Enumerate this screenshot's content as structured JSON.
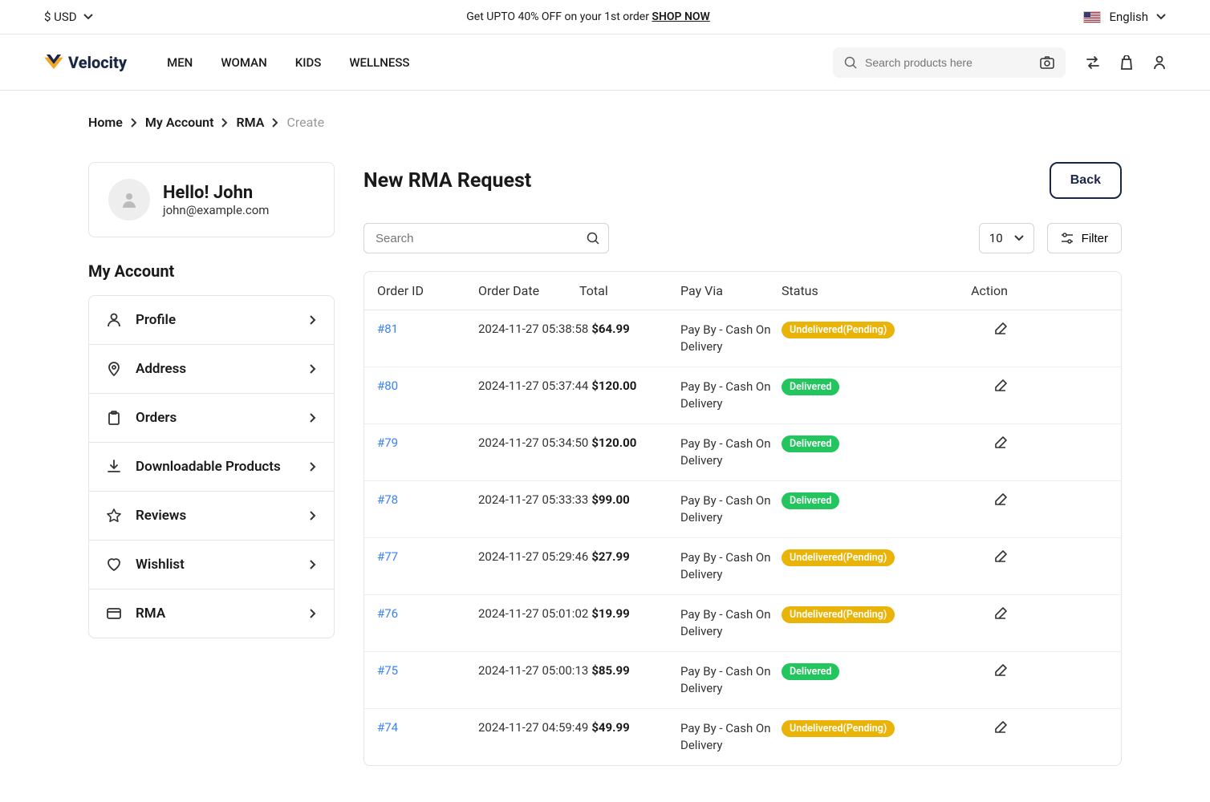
{
  "topbar": {
    "currency": "$ USD",
    "promo_prefix": "Get UPTO 40% OFF on your 1st order ",
    "promo_cta": "SHOP NOW",
    "language": "English"
  },
  "header": {
    "logo_text": "Velocity",
    "nav": [
      "MEN",
      "WOMAN",
      "KIDS",
      "WELLNESS"
    ],
    "search_placeholder": "Search products here"
  },
  "breadcrumb": [
    "Home",
    "My Account",
    "RMA",
    "Create"
  ],
  "user": {
    "greeting": "Hello! John",
    "email": "john@example.com"
  },
  "sidebar": {
    "title": "My Account",
    "items": [
      {
        "label": "Profile",
        "icon": "user"
      },
      {
        "label": "Address",
        "icon": "pin"
      },
      {
        "label": "Orders",
        "icon": "clipboard"
      },
      {
        "label": "Downloadable Products",
        "icon": "download"
      },
      {
        "label": "Reviews",
        "icon": "star"
      },
      {
        "label": "Wishlist",
        "icon": "heart"
      },
      {
        "label": "RMA",
        "icon": "card"
      }
    ]
  },
  "main": {
    "title": "New RMA Request",
    "back_label": "Back",
    "search_placeholder": "Search",
    "page_size": "10",
    "filter_label": "Filter",
    "columns": [
      "Order ID",
      "Order Date",
      "Total",
      "Pay Via",
      "Status",
      "Action"
    ],
    "rows": [
      {
        "id": "#81",
        "date": "2024-11-27 05:38:58",
        "total": "$64.99",
        "pay": "Pay By - Cash On Delivery",
        "status": "Undelivered(Pending)",
        "status_type": "pending"
      },
      {
        "id": "#80",
        "date": "2024-11-27 05:37:44",
        "total": "$120.00",
        "pay": "Pay By - Cash On Delivery",
        "status": "Delivered",
        "status_type": "delivered"
      },
      {
        "id": "#79",
        "date": "2024-11-27 05:34:50",
        "total": "$120.00",
        "pay": "Pay By - Cash On Delivery",
        "status": "Delivered",
        "status_type": "delivered"
      },
      {
        "id": "#78",
        "date": "2024-11-27 05:33:33",
        "total": "$99.00",
        "pay": "Pay By - Cash On Delivery",
        "status": "Delivered",
        "status_type": "delivered"
      },
      {
        "id": "#77",
        "date": "2024-11-27 05:29:46",
        "total": "$27.99",
        "pay": "Pay By - Cash On Delivery",
        "status": "Undelivered(Pending)",
        "status_type": "pending"
      },
      {
        "id": "#76",
        "date": "2024-11-27 05:01:02",
        "total": "$19.99",
        "pay": "Pay By - Cash On Delivery",
        "status": "Undelivered(Pending)",
        "status_type": "pending"
      },
      {
        "id": "#75",
        "date": "2024-11-27 05:00:13",
        "total": "$85.99",
        "pay": "Pay By - Cash On Delivery",
        "status": "Delivered",
        "status_type": "delivered"
      },
      {
        "id": "#74",
        "date": "2024-11-27 04:59:49",
        "total": "$49.99",
        "pay": "Pay By - Cash On Delivery",
        "status": "Undelivered(Pending)",
        "status_type": "pending"
      }
    ]
  }
}
